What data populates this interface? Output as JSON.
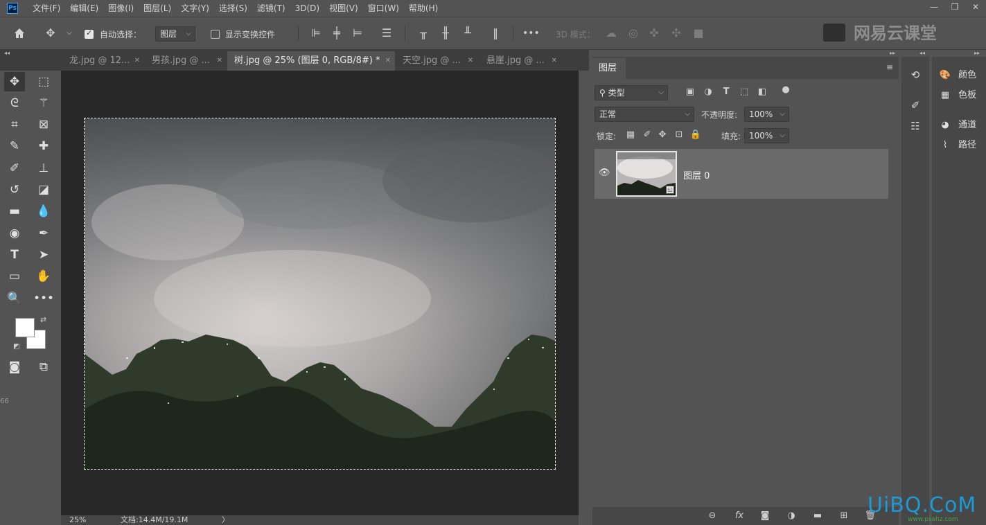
{
  "app": {
    "logo_text": "Ps",
    "menu": [
      "文件(F)",
      "编辑(E)",
      "图像(I)",
      "图层(L)",
      "文字(Y)",
      "选择(S)",
      "滤镜(T)",
      "3D(D)",
      "视图(V)",
      "窗口(W)",
      "帮助(H)"
    ],
    "window_controls": [
      "—",
      "❐",
      "✕"
    ]
  },
  "options_bar": {
    "auto_select_label": "自动选择：",
    "auto_select_checked": true,
    "auto_select_target": "图层",
    "show_transform_label": "显示变换控件",
    "show_transform_checked": false,
    "mode_3d_label": "3D 模式：",
    "more_label": "•••"
  },
  "brand": {
    "text": "网易云课堂"
  },
  "tabs": [
    {
      "label": "龙.jpg @ 12...",
      "active": false
    },
    {
      "label": "男孩.jpg @ ...",
      "active": false
    },
    {
      "label": "树.jpg @ 25% (图层 0, RGB/8#) *",
      "active": true
    },
    {
      "label": "天空.jpg @ ...",
      "active": false
    },
    {
      "label": "悬崖.jpg @ ...",
      "active": false
    }
  ],
  "colors": {
    "foreground": "#ffffff",
    "background": "#ffffff",
    "selected_layer_bg": "#6a6a6a",
    "watermark": "#1b9ad6"
  },
  "status": {
    "zoom": "25%",
    "doc_info": "文档:14.4M/19.1M",
    "arrow": "〉",
    "edge_number": "66"
  },
  "layers_panel": {
    "tab_label": "图层",
    "filter_kind": "类型",
    "blend_mode": "正常",
    "opacity_label": "不透明度:",
    "opacity_value": "100%",
    "lock_label": "锁定:",
    "fill_label": "填充:",
    "fill_value": "100%",
    "layers": [
      {
        "name": "图层 0",
        "visible": true
      }
    ]
  },
  "side_panels": [
    {
      "icon": "palette-icon",
      "label": "颜色"
    },
    {
      "icon": "swatches-icon",
      "label": "色板"
    },
    {
      "icon": "channels-icon",
      "label": "通道"
    },
    {
      "icon": "paths-icon",
      "label": "路径"
    }
  ],
  "watermark": {
    "text": "UiBQ.CoM",
    "sub": "www.psahz.com"
  }
}
